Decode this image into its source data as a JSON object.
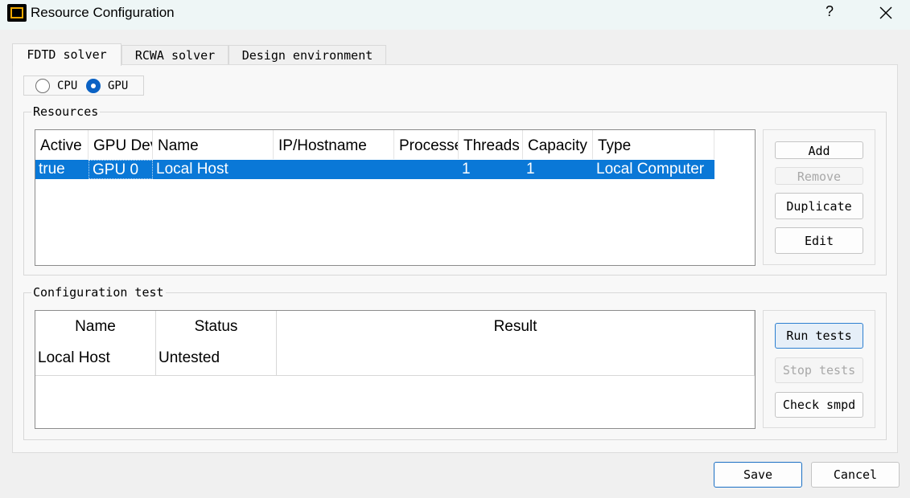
{
  "window": {
    "title": "Resource Configuration",
    "help_label": "?"
  },
  "tabs": [
    {
      "label": "FDTD solver",
      "active": true
    },
    {
      "label": "RCWA solver",
      "active": false
    },
    {
      "label": "Design environment",
      "active": false
    }
  ],
  "device_mode": {
    "options": [
      "CPU",
      "GPU"
    ],
    "selected": "GPU"
  },
  "resources": {
    "title": "Resources",
    "columns": [
      "Active",
      "GPU Dev",
      "Name",
      "IP/Hostname",
      "Processes",
      "Threads",
      "Capacity",
      "Type"
    ],
    "rows": [
      {
        "active": "true",
        "gpu_device": "GPU 0",
        "name": "Local Host",
        "ip_hostname": "",
        "processes": "",
        "threads": "1",
        "capacity": "1",
        "type": "Local Computer"
      }
    ],
    "buttons": {
      "add": "Add",
      "remove": "Remove",
      "duplicate": "Duplicate",
      "edit": "Edit"
    }
  },
  "config_test": {
    "title": "Configuration test",
    "columns": [
      "Name",
      "Status",
      "Result"
    ],
    "rows": [
      {
        "name": "Local Host",
        "status": "Untested",
        "result": ""
      }
    ],
    "buttons": {
      "run": "Run tests",
      "stop": "Stop tests",
      "check": "Check smpd"
    }
  },
  "footer": {
    "save": "Save",
    "cancel": "Cancel"
  },
  "colors": {
    "selection": "#0a78d7",
    "radio_checked": "#0b62c4",
    "icon_accent": "#f0a800"
  }
}
